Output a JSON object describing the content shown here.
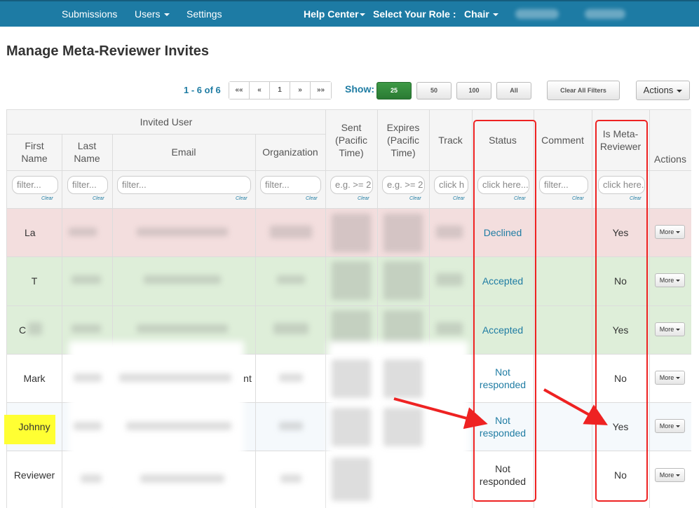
{
  "nav": {
    "submissions": "Submissions",
    "users": "Users",
    "settings": "Settings",
    "help_center": "Help Center",
    "select_role_label": "Select Your Role :",
    "role": "Chair"
  },
  "page_title": "Manage Meta-Reviewer Invites",
  "toolbar": {
    "range": "1 - 6 of 6",
    "pager": [
      "««",
      "«",
      "1",
      "»",
      "»»"
    ],
    "show_label": "Show:",
    "page_sizes": [
      "25",
      "50",
      "100",
      "All"
    ],
    "active_page_size": "25",
    "clear_filters": "Clear All Filters",
    "actions": "Actions"
  },
  "table": {
    "group_header": "Invited User",
    "columns": {
      "first_name": "First Name",
      "last_name": "Last Name",
      "email": "Email",
      "organization": "Organization",
      "sent": "Sent (Pacific Time)",
      "expires": "Expires (Pacific Time)",
      "track": "Track",
      "status": "Status",
      "comment": "Comment",
      "is_meta_reviewer": "Is Meta-Reviewer",
      "actions": "Actions"
    },
    "filters": {
      "first_name": "filter...",
      "last_name": "filter...",
      "email": "filter...",
      "organization": "filter...",
      "sent": "e.g. >= 2",
      "expires": "e.g. >= 2",
      "track": "click h",
      "status": "click here...",
      "comment": "filter...",
      "is_meta_reviewer": "click here...",
      "clear": "Clear"
    },
    "rows": [
      {
        "first_name": "La",
        "status": "Declined",
        "is_meta_reviewer": "Yes",
        "more": "More",
        "email_suffix": ""
      },
      {
        "first_name": "T",
        "status": "Accepted",
        "is_meta_reviewer": "No",
        "more": "More",
        "email_suffix": ""
      },
      {
        "first_name": "C",
        "status": "Accepted",
        "is_meta_reviewer": "Yes",
        "more": "More",
        "email_suffix": ""
      },
      {
        "first_name": "Mark",
        "status": "Not responded",
        "is_meta_reviewer": "No",
        "more": "More",
        "email_suffix": "nt"
      },
      {
        "first_name": "Johnny",
        "status": "Not responded",
        "is_meta_reviewer": "Yes",
        "more": "More",
        "email_suffix": ""
      },
      {
        "first_name": "Reviewer",
        "status": "Not responded",
        "is_meta_reviewer": "No",
        "more": "More",
        "email_suffix": ""
      }
    ]
  },
  "colors": {
    "navbar": "#1d7ba4",
    "accent_text": "#1f7ca3",
    "declined_row": "#f3dede",
    "accepted_row": "#deeed9",
    "active_page_size": "#2f8a38",
    "annotation_red": "#ee2222",
    "highlight_yellow": "#ffff33"
  }
}
